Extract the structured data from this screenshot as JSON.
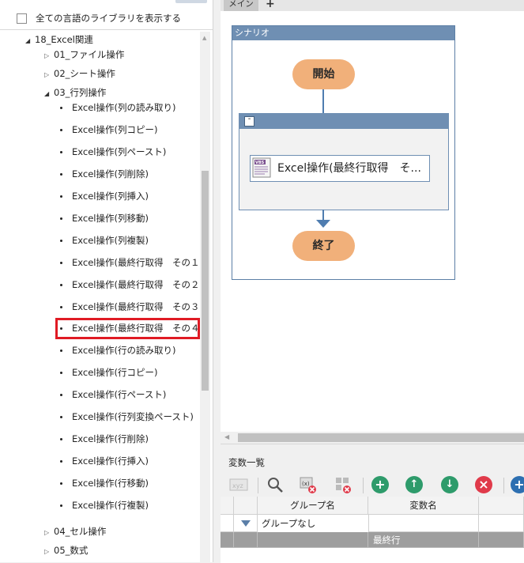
{
  "library": {
    "show_all_languages_label": "全ての言語のライブラリを表示する",
    "tree": {
      "root": {
        "label": "18_Excel関連",
        "expanded": true
      },
      "folders_top": [
        {
          "label": "01_ファイル操作",
          "expanded": false
        },
        {
          "label": "02_シート操作",
          "expanded": false
        }
      ],
      "open_folder": {
        "label": "03_行列操作",
        "expanded": true
      },
      "items": [
        "Excel操作(列の読み取り)",
        "Excel操作(列コピー)",
        "Excel操作(列ペースト)",
        "Excel操作(列削除)",
        "Excel操作(列挿入)",
        "Excel操作(列移動)",
        "Excel操作(列複製)",
        "Excel操作(最終行取得　その１",
        "Excel操作(最終行取得　その２",
        "Excel操作(最終行取得　その３",
        "Excel操作(最終行取得　その４",
        "Excel操作(行の読み取り)",
        "Excel操作(行コピー)",
        "Excel操作(行ペースト)",
        "Excel操作(行列変換ペースト)",
        "Excel操作(行削除)",
        "Excel操作(行挿入)",
        "Excel操作(行移動)",
        "Excel操作(行複製)"
      ],
      "highlighted_item": "Excel操作(最終行取得　その４",
      "folders_bottom": [
        {
          "label": "04_セル操作",
          "expanded": false
        },
        {
          "label": "05_数式",
          "expanded": false
        }
      ]
    }
  },
  "tabs": {
    "main_label": "メイン",
    "add_icon": "plus-icon"
  },
  "flow": {
    "scenario_title": "シナリオ",
    "start_label": "開始",
    "end_label": "終了",
    "group_collapse_symbol": "-",
    "activity": {
      "icon": "vbs-script-icon",
      "icon_text": "VBS",
      "label": "Excel操作(最終行取得　そ..."
    },
    "colors": {
      "node": "#f1b07a",
      "frame": "#6f8fb3",
      "connector": "#4f7db0"
    }
  },
  "variables": {
    "title": "変数一覧",
    "toolbar": {
      "tooltips": [],
      "icons": [
        "variable-type-icon",
        "search-icon",
        "clear-variable-icon",
        "delete-grid-icon",
        "add-icon",
        "move-up-icon",
        "move-down-icon",
        "delete-icon",
        "add-more-icon"
      ],
      "colors": {
        "add": "#2e9b6b",
        "up": "#2e9b6b",
        "down": "#2e9b6b",
        "delete": "#e03a4a",
        "more": "#2d6fb1"
      }
    },
    "columns": [
      "グループ名",
      "変数名"
    ],
    "group_row": {
      "expand_icon": "triangle-down-icon",
      "label": "グループなし"
    },
    "selected_row": {
      "name": "最終行"
    }
  }
}
